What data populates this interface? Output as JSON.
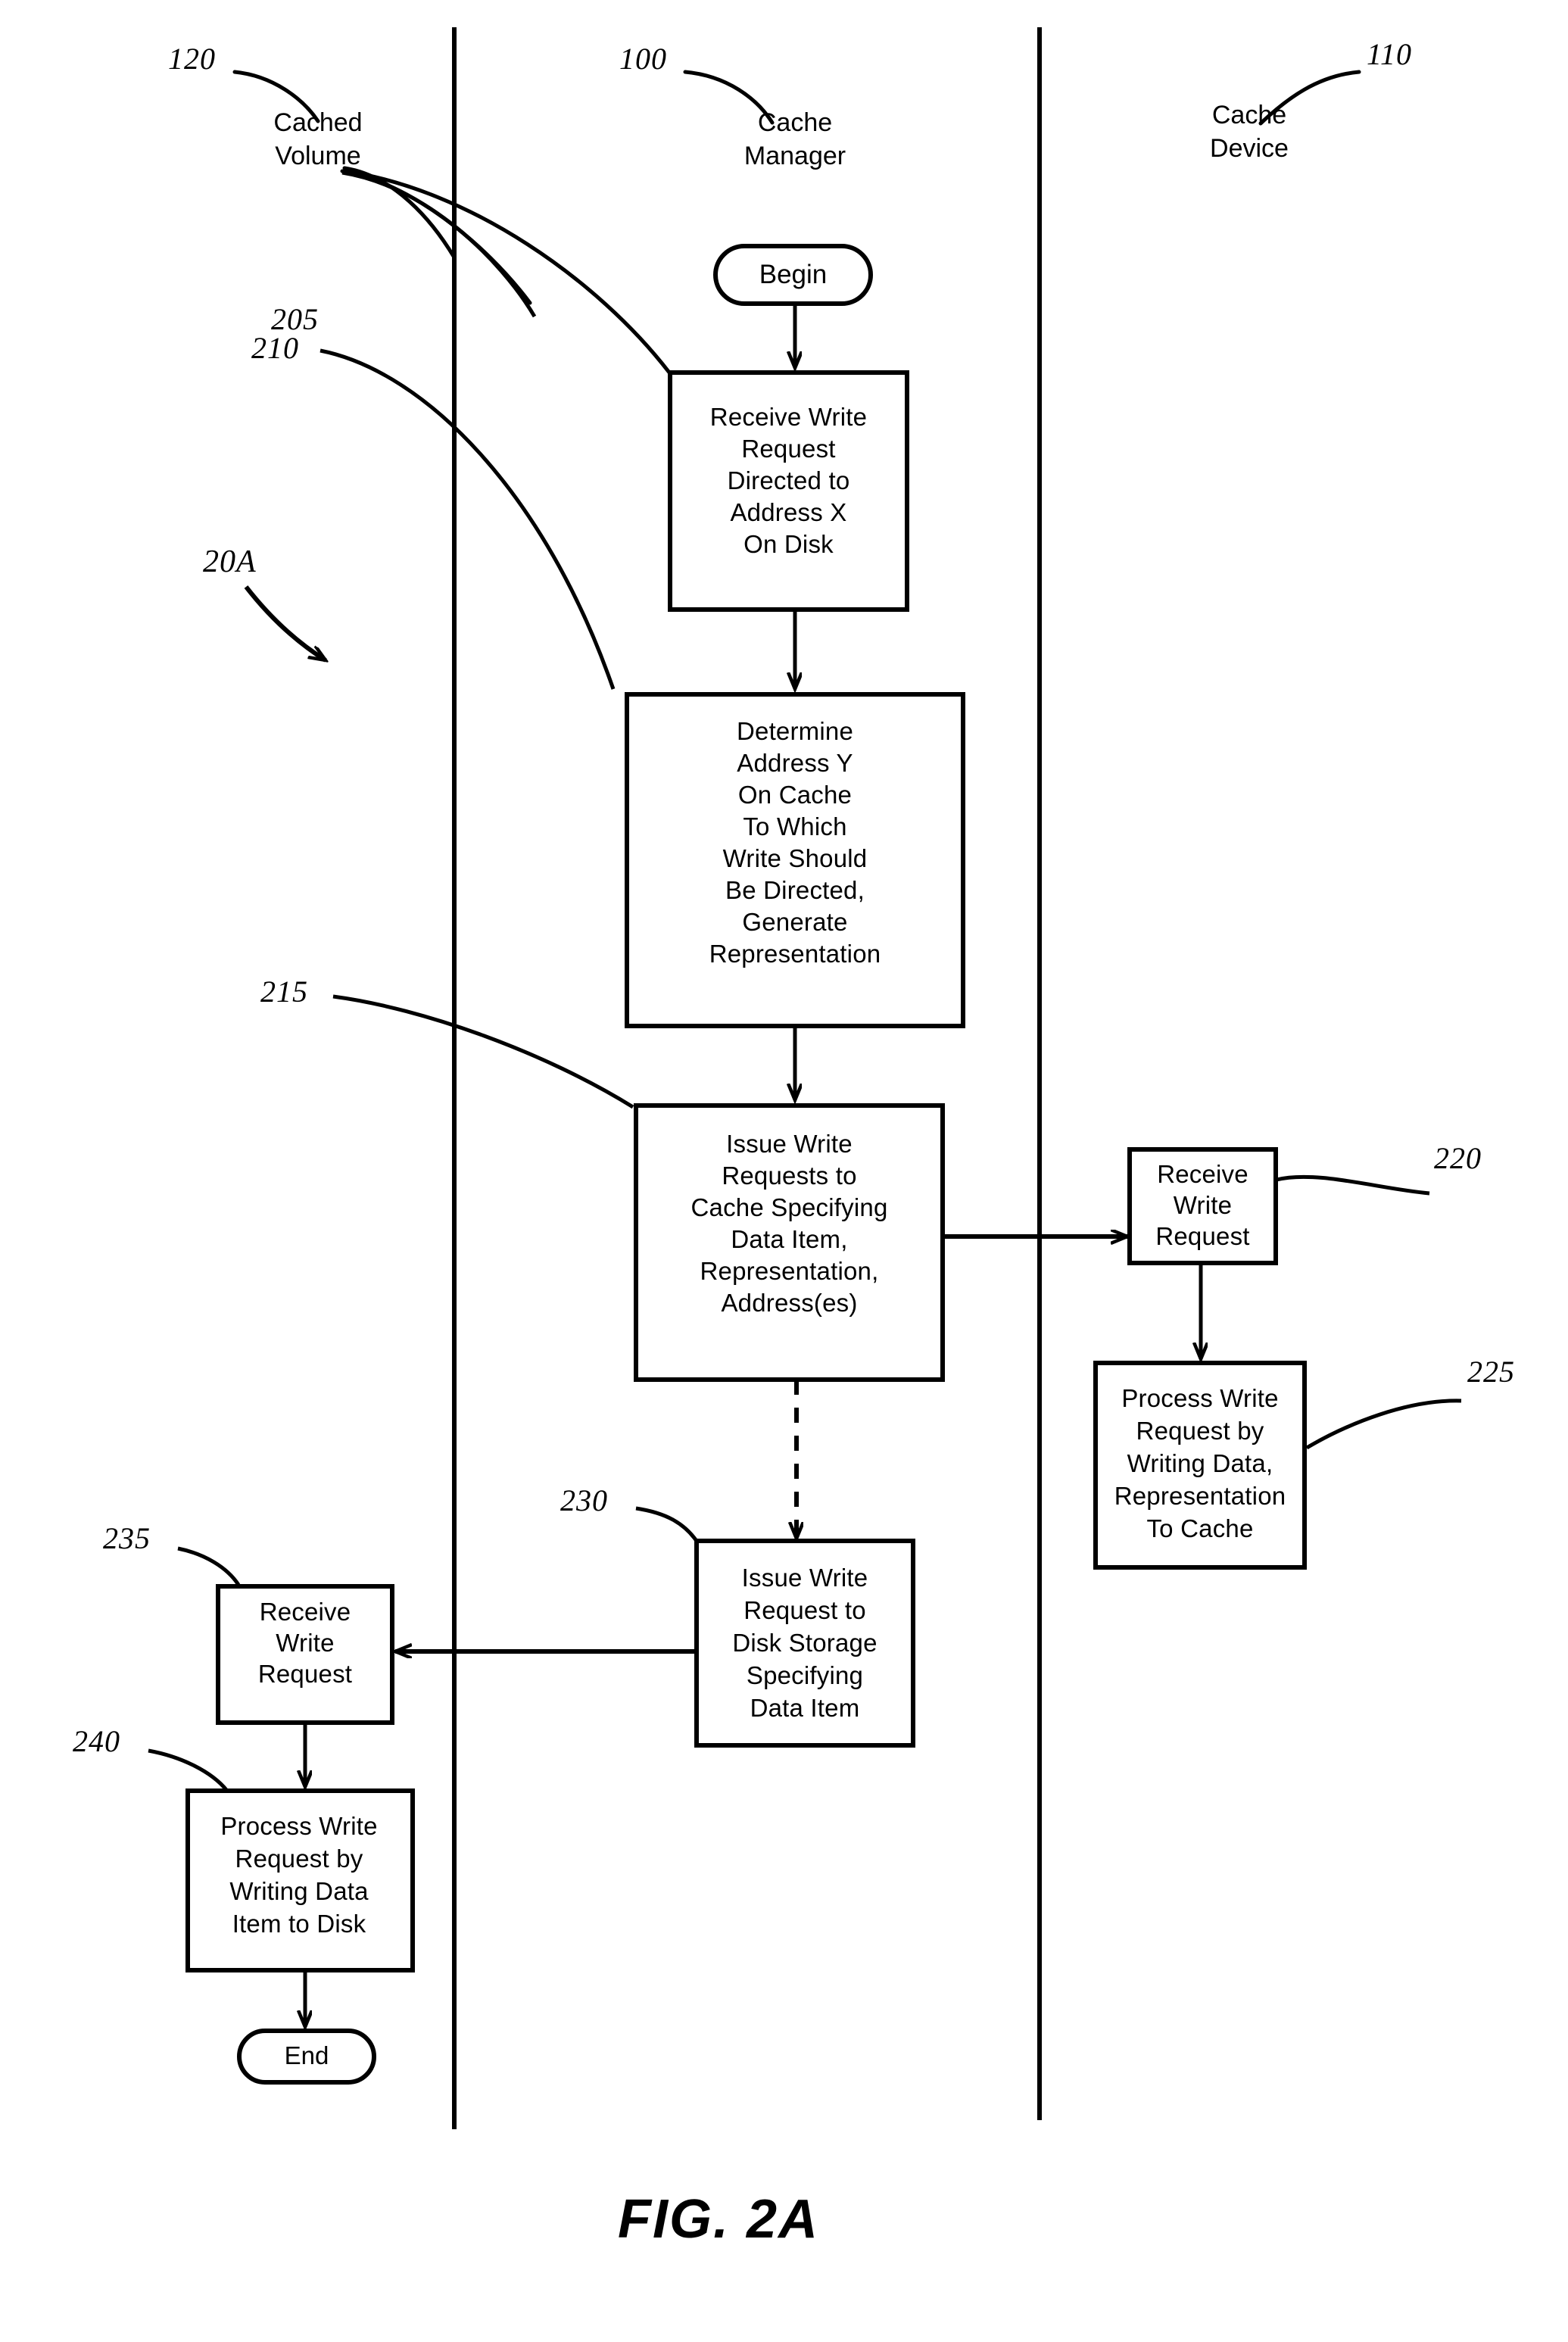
{
  "figure": {
    "caption": "FIG. 2A",
    "diagram_ref": "20A"
  },
  "lanes": [
    {
      "ref": "120",
      "label": "Cached\nVolume"
    },
    {
      "ref": "100",
      "label": "Cache\nManager"
    },
    {
      "ref": "110",
      "label": "Cache\nDevice"
    }
  ],
  "terminals": {
    "begin": "Begin",
    "end": "End"
  },
  "nodes": [
    {
      "ref": "205",
      "text": "Receive Write\nRequest\nDirected to\nAddress X\nOn Disk"
    },
    {
      "ref": "210",
      "text": "Determine\nAddress Y\nOn Cache\nTo Which\nWrite Should\nBe Directed,\nGenerate\nRepresentation"
    },
    {
      "ref": "215",
      "text": "Issue Write\nRequests to\nCache Specifying\nData Item,\nRepresentation,\nAddress(es)"
    },
    {
      "ref": "220",
      "text": "Receive\nWrite\nRequest"
    },
    {
      "ref": "225",
      "text": "Process Write\nRequest by\nWriting Data,\nRepresentation\nTo Cache"
    },
    {
      "ref": "230",
      "text": "Issue Write\nRequest to\nDisk Storage\nSpecifying\nData Item"
    },
    {
      "ref": "235",
      "text": "Receive\nWrite\nRequest"
    },
    {
      "ref": "240",
      "text": "Process Write\nRequest by\nWriting Data\nItem to Disk"
    }
  ],
  "colors": {
    "ink": "#000000",
    "paper": "#ffffff"
  }
}
